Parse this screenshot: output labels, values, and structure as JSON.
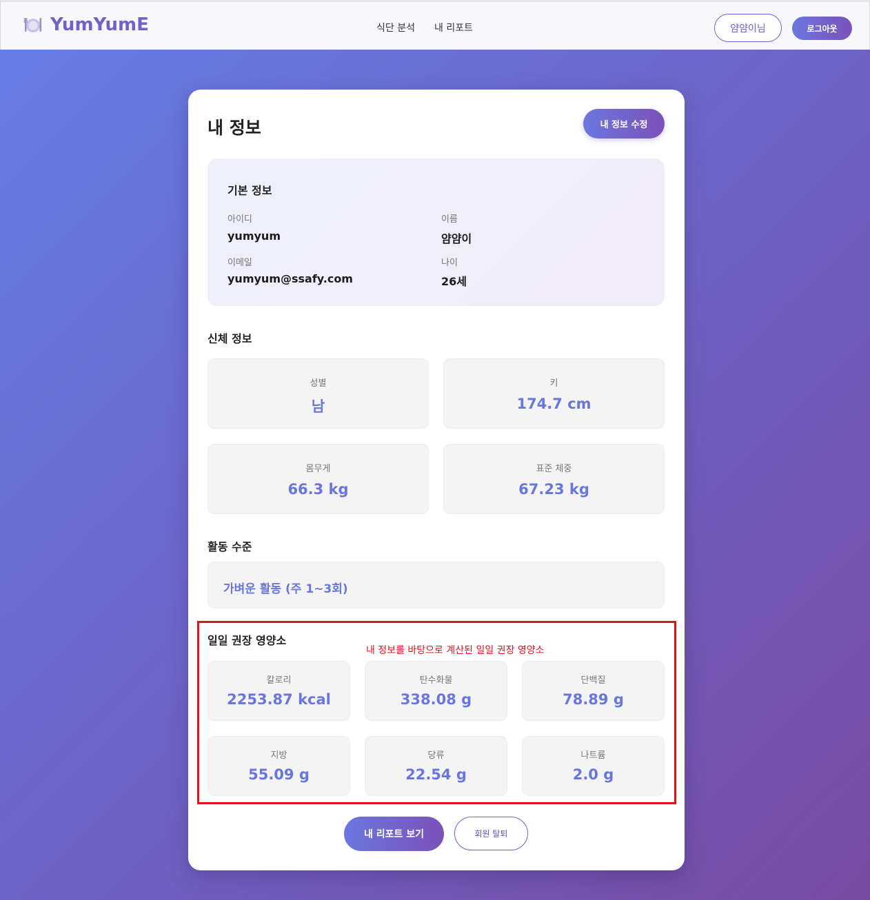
{
  "header": {
    "brand": "YumYumE",
    "brand_icon": "plate-cutlery-icon",
    "nav": [
      "식단 분석",
      "내 리포트"
    ],
    "user_label": "얌얌이님",
    "logout_label": "로그아웃"
  },
  "profile": {
    "title": "내 정보",
    "edit_label": "내 정보 수정",
    "basic": {
      "title": "기본 정보",
      "id_label": "아이디",
      "id_value": "yumyum",
      "name_label": "이름",
      "name_value": "얌얌이",
      "email_label": "이메일",
      "email_value": "yumyum@ssafy.com",
      "age_label": "나이",
      "age_value": "26세"
    },
    "body": {
      "title": "신체 정보",
      "items": [
        {
          "label": "성별",
          "value": "남"
        },
        {
          "label": "키",
          "value": "174.7 cm"
        },
        {
          "label": "몸무게",
          "value": "66.3 kg"
        },
        {
          "label": "표준 체중",
          "value": "67.23 kg"
        }
      ]
    },
    "activity": {
      "title": "활동 수준",
      "value": "가벼운 활동 (주 1~3회)"
    },
    "nutrition": {
      "title": "일일 권장 영양소",
      "annotation": "내 정보를 바탕으로 계산된 일일 권장 영양소",
      "items": [
        {
          "label": "칼로리",
          "value": "2253.87 kcal"
        },
        {
          "label": "탄수화물",
          "value": "338.08 g"
        },
        {
          "label": "단백질",
          "value": "78.89 g"
        },
        {
          "label": "지방",
          "value": "55.09 g"
        },
        {
          "label": "당류",
          "value": "22.54 g"
        },
        {
          "label": "나트륨",
          "value": "2.0 g"
        }
      ]
    },
    "actions": {
      "report_label": "내 리포트 보기",
      "withdraw_label": "회원 탈퇴"
    }
  },
  "colors": {
    "accent": "#6877dd",
    "brand": "#7360c9",
    "highlight": "#e0141b"
  }
}
